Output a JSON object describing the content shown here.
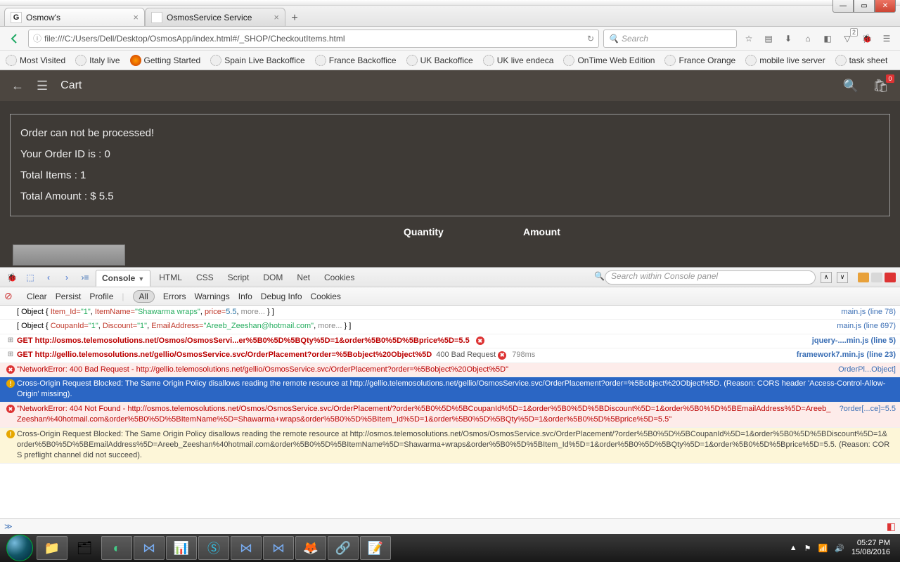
{
  "window": {
    "min": "—",
    "max": "▭",
    "close": "✕"
  },
  "tabs": [
    {
      "favicon": "G",
      "title": "Osmow's"
    },
    {
      "favicon": "",
      "title": "OsmosService Service"
    }
  ],
  "url": "file:///C:/Users/Dell/Desktop/OsmosApp/index.html#/_SHOP/CheckoutItems.html",
  "search_placeholder": "Search",
  "bookmarks": [
    "Most Visited",
    "Italy live",
    "Getting Started",
    "Spain Live Backoffice",
    "France Backoffice",
    "UK Backoffice",
    "UK live endeca",
    "OnTime Web Edition",
    "France Orange",
    "mobile live server",
    "task sheet"
  ],
  "app": {
    "title": "Cart",
    "bag_count": "0",
    "order": {
      "l1": "Order can not be processed!",
      "l2": "Your Order ID is : 0",
      "l3": "Total Items : 1",
      "l4": "Total Amount : $ 5.5"
    },
    "cols": {
      "qty": "Quantity",
      "amt": "Amount"
    }
  },
  "devtools": {
    "tabs": [
      "Console",
      "HTML",
      "CSS",
      "Script",
      "DOM",
      "Net",
      "Cookies"
    ],
    "search_placeholder": "Search within Console panel",
    "subtabs": [
      "Clear",
      "Persist",
      "Profile"
    ],
    "filters": [
      "All",
      "Errors",
      "Warnings",
      "Info",
      "Debug Info",
      "Cookies"
    ],
    "log": {
      "obj1_pre": "[ Object { ",
      "obj1_k1": "Item_Id=",
      "obj1_v1": "\"1\"",
      "obj1_c1": ",   ",
      "obj1_k2": "ItemName=",
      "obj1_v2": "\"Shawarma wraps\"",
      "obj1_c2": ",   ",
      "obj1_k3": "price=",
      "obj1_v3": "5.5",
      "obj1_c3": ",   ",
      "obj1_more": "more... ",
      "obj1_suf": "} ]",
      "obj1_src": "main.js (line 78)",
      "obj2_pre": "[ Object { ",
      "obj2_k1": "CoupanId=",
      "obj2_v1": "\"1\"",
      "obj2_c1": ",   ",
      "obj2_k2": "Discount=",
      "obj2_v2": "\"1\"",
      "obj2_c2": ",   ",
      "obj2_k3": "EmailAddress=",
      "obj2_v3": "\"Areeb_Zeeshan@hotmail.com\"",
      "obj2_c3": ",   ",
      "obj2_more": "more... ",
      "obj2_suf": "} ]",
      "obj2_src": "main.js (line 697)",
      "get1": "GET http://osmos.telemosolutions.net/Osmos/OsmosServi...er%5B0%5D%5BQty%5D=1&order%5B0%5D%5Bprice%5D=5.5",
      "get1_src": "jquery-....min.js (line 5)",
      "get2": "GET http://gellio.telemosolutions.net/gellio/OsmosService.svc/OrderPlacement?order=%5Bobject%20Object%5D",
      "get2_status": "400 Bad Request",
      "get2_ms": "798ms",
      "get2_src": "framework7.min.js (line 23)",
      "err1": "\"NetworkError: 400 Bad Request - http://gellio.telemosolutions.net/gellio/OsmosService.svc/OrderPlacement?order=%5Bobject%20Object%5D\"",
      "err1_src": "OrderPl...Object]",
      "cors1": "Cross-Origin Request Blocked: The Same Origin Policy disallows reading the remote resource at http://gellio.telemosolutions.net/gellio/OsmosService.svc/OrderPlacement?order=%5Bobject%20Object%5D. (Reason: CORS header 'Access-Control-Allow-Origin' missing).",
      "err2": "\"NetworkError: 404 Not Found - http://osmos.telemosolutions.net/Osmos/OsmosService.svc/OrderPlacement/?order%5B0%5D%5BCoupanId%5D=1&order%5B0%5D%5BDiscount%5D=1&order%5B0%5D%5BEmailAddress%5D=Areeb_Zeeshan%40hotmail.com&order%5B0%5D%5BItemName%5D=Shawarma+wraps&order%5B0%5D%5BItem_Id%5D=1&order%5B0%5D%5BQty%5D=1&order%5B0%5D%5Bprice%5D=5.5\"",
      "err2_src": "?order[...ce]=5.5",
      "cors2": "Cross-Origin Request Blocked: The Same Origin Policy disallows reading the remote resource at http://osmos.telemosolutions.net/Osmos/OsmosService.svc/OrderPlacement/?order%5B0%5D%5BCoupanId%5D=1&order%5B0%5D%5BDiscount%5D=1&order%5B0%5D%5BEmailAddress%5D=Areeb_Zeeshan%40hotmail.com&order%5B0%5D%5BItemName%5D=Shawarma+wraps&order%5B0%5D%5BItem_Id%5D=1&order%5B0%5D%5BQty%5D=1&order%5B0%5D%5Bprice%5D=5.5. (Reason: CORS preflight channel did not succeed)."
    }
  },
  "clock": {
    "time": "05:27 PM",
    "date": "15/08/2016"
  },
  "pocket_badge": "2"
}
